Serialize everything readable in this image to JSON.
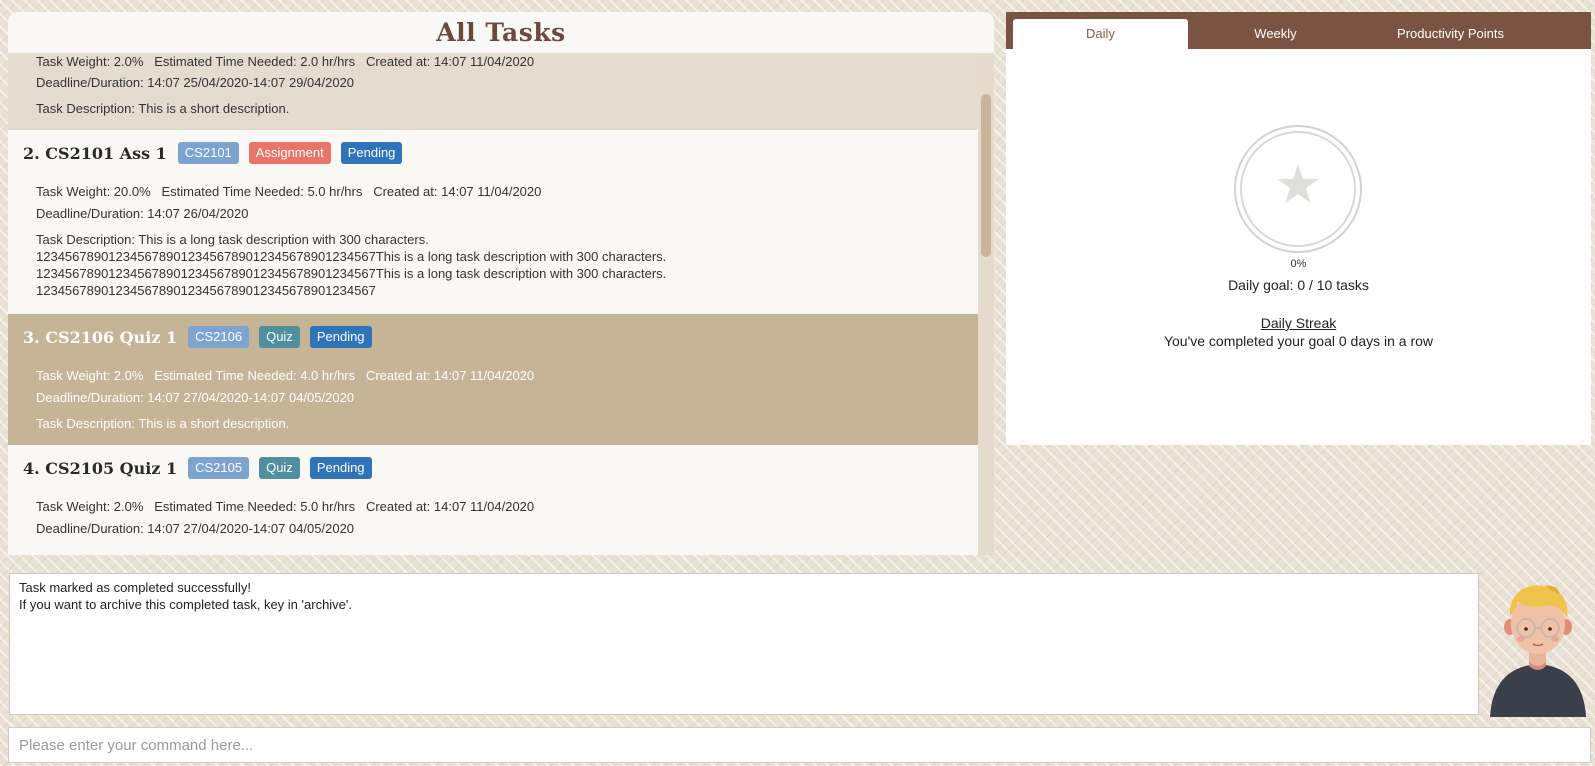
{
  "task_list": {
    "title": "All Tasks",
    "tasks": [
      {
        "weight_line": "Task Weight: 2.0%   Estimated Time Needed: 2.0 hr/hrs   Created at: 14:07 11/04/2020",
        "deadline": "Deadline/Duration: 14:07 25/04/2020-14:07 29/04/2020",
        "description": [
          "Task Description: This is a short description."
        ]
      },
      {
        "name": "2.  CS2101 Ass 1",
        "module": "CS2101",
        "type": "Assignment",
        "status": "Pending",
        "weight_line": "Task Weight: 20.0%   Estimated Time Needed: 5.0 hr/hrs   Created at: 14:07 11/04/2020",
        "deadline": "Deadline/Duration: 14:07 26/04/2020",
        "description": [
          "Task Description: This is a long task description with 300 characters.",
          "12345678901234567890123456789012345678901234567This is a long task description with 300 characters.",
          "12345678901234567890123456789012345678901234567This is a long task description with 300 characters.",
          "12345678901234567890123456789012345678901234567"
        ]
      },
      {
        "name": "3.  CS2106 Quiz 1",
        "module": "CS2106",
        "type": "Quiz",
        "status": "Pending",
        "weight_line": "Task Weight: 2.0%   Estimated Time Needed: 4.0 hr/hrs   Created at: 14:07 11/04/2020",
        "deadline": "Deadline/Duration: 14:07 27/04/2020-14:07 04/05/2020",
        "description": [
          "Task Description: This is a short description."
        ]
      },
      {
        "name": "4.  CS2105 Quiz 1",
        "module": "CS2105",
        "type": "Quiz",
        "status": "Pending",
        "weight_line": "Task Weight: 2.0%   Estimated Time Needed: 5.0 hr/hrs   Created at: 14:07 11/04/2020",
        "deadline": "Deadline/Duration: 14:07 27/04/2020-14:07 04/05/2020"
      }
    ]
  },
  "stats": {
    "tabs": [
      "Daily",
      "Weekly",
      "Productivity Points"
    ],
    "active_tab": "Daily",
    "progress_percent": "0%",
    "daily_goal": "Daily goal:  0 / 10 tasks",
    "streak_title": "Daily Streak",
    "streak_text": "You've completed your goal 0 days in a row",
    "icon": "star-icon"
  },
  "result": {
    "lines": [
      "Task marked as completed successfully!",
      "If you want to archive this completed task, key in 'archive'."
    ]
  },
  "command": {
    "placeholder": "Please enter your command here..."
  },
  "colors": {
    "brand_brown": "#7b5341",
    "selected_row": "#c6b496",
    "tag_module": "#7da4d1",
    "tag_assignment": "#e9756a",
    "tag_quiz": "#4f8fa0",
    "tag_pending": "#2f73b8"
  }
}
